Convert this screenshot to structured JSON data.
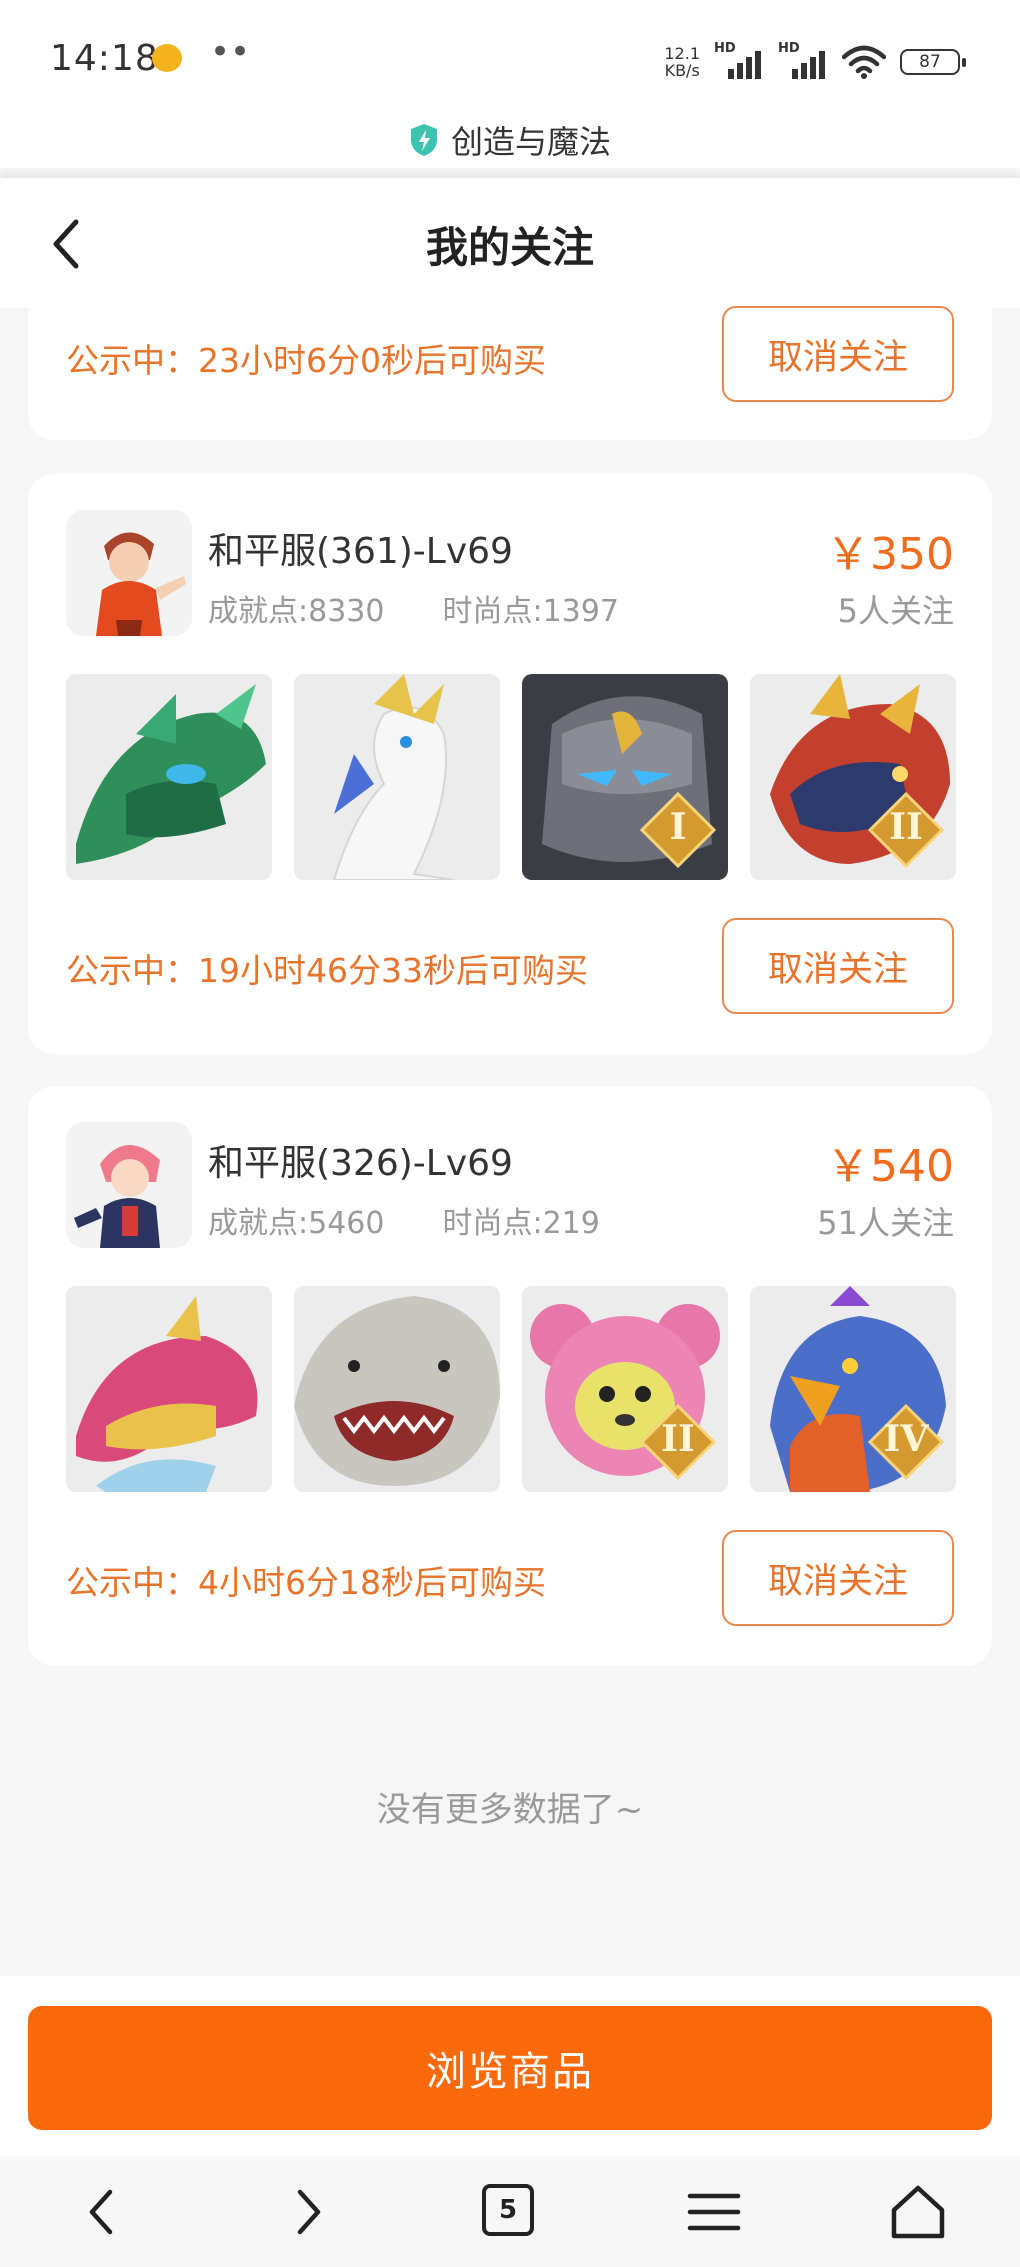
{
  "status_bar": {
    "time": "14:18",
    "dots": "••",
    "net_speed_value": "12.1",
    "net_speed_unit": "KB/s",
    "signal1_label": "HD",
    "signal2_label": "HD",
    "battery": "87"
  },
  "site": {
    "title": "创造与魔法",
    "icon": "shield-bolt-icon"
  },
  "header": {
    "title": "我的关注",
    "back_icon": "chevron-left-icon"
  },
  "listings": [
    {
      "public_text": "公示中：23小时6分0秒后可购买",
      "cancel_label": "取消关注"
    },
    {
      "name": "和平服(361)-Lv69",
      "achievement": "成就点:8330",
      "fashion": "时尚点:1397",
      "price": "￥350",
      "followers": "5人关注",
      "items": [
        {
          "icon": "green-dragon-icon"
        },
        {
          "icon": "swan-icon"
        },
        {
          "icon": "stone-golem-icon",
          "grade": "I"
        },
        {
          "icon": "fire-dragon-icon",
          "grade": "II"
        }
      ],
      "public_text": "公示中：19小时46分33秒后可购买",
      "cancel_label": "取消关注"
    },
    {
      "name": "和平服(326)-Lv69",
      "achievement": "成就点:5460",
      "fashion": "时尚点:219",
      "price": "￥540",
      "followers": "51人关注",
      "items": [
        {
          "icon": "pink-dragon-icon"
        },
        {
          "icon": "shark-icon"
        },
        {
          "icon": "pink-bear-icon",
          "grade": "II"
        },
        {
          "icon": "phoenix-bird-icon",
          "grade": "IV"
        }
      ],
      "public_text": "公示中：4小时6分18秒后可购买",
      "cancel_label": "取消关注"
    }
  ],
  "no_more": "没有更多数据了~",
  "browse_button": "浏览商品",
  "navbar": {
    "tab_count": "5"
  },
  "colors": {
    "accent": "#fa6a0d",
    "price": "#f26c1d",
    "public_text": "#e8732a"
  }
}
